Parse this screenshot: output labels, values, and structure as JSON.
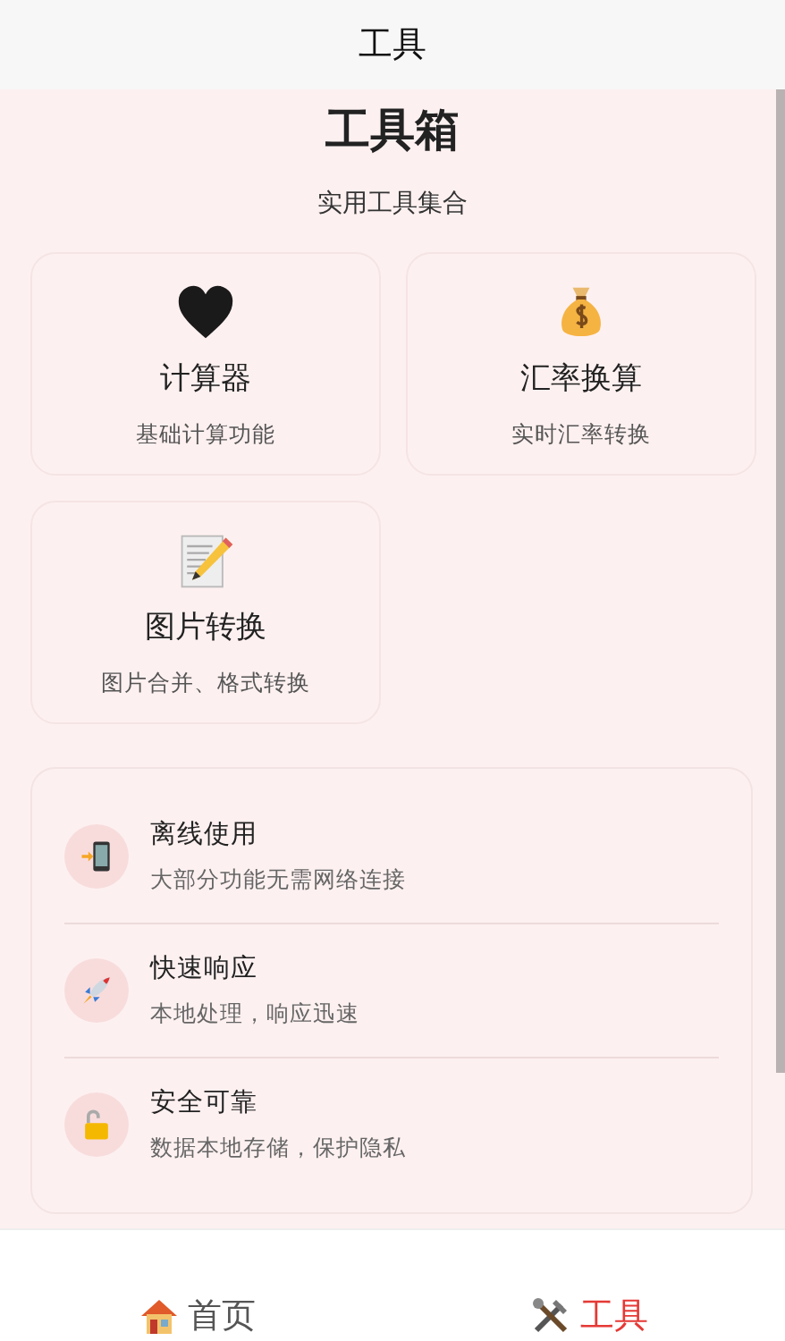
{
  "header": {
    "title": "工具"
  },
  "hero": {
    "title": "工具箱",
    "subtitle": "实用工具集合"
  },
  "tools": [
    {
      "title": "计算器",
      "description": "基础计算功能"
    },
    {
      "title": "汇率换算",
      "description": "实时汇率转换"
    },
    {
      "title": "图片转换",
      "description": "图片合并、格式转换"
    }
  ],
  "features": [
    {
      "title": "离线使用",
      "description": "大部分功能无需网络连接"
    },
    {
      "title": "快速响应",
      "description": "本地处理，响应迅速"
    },
    {
      "title": "安全可靠",
      "description": "数据本地存储，保护隐私"
    }
  ],
  "tab_bar": [
    {
      "label": "首页",
      "selected": false
    },
    {
      "label": "工具",
      "selected": true
    }
  ]
}
